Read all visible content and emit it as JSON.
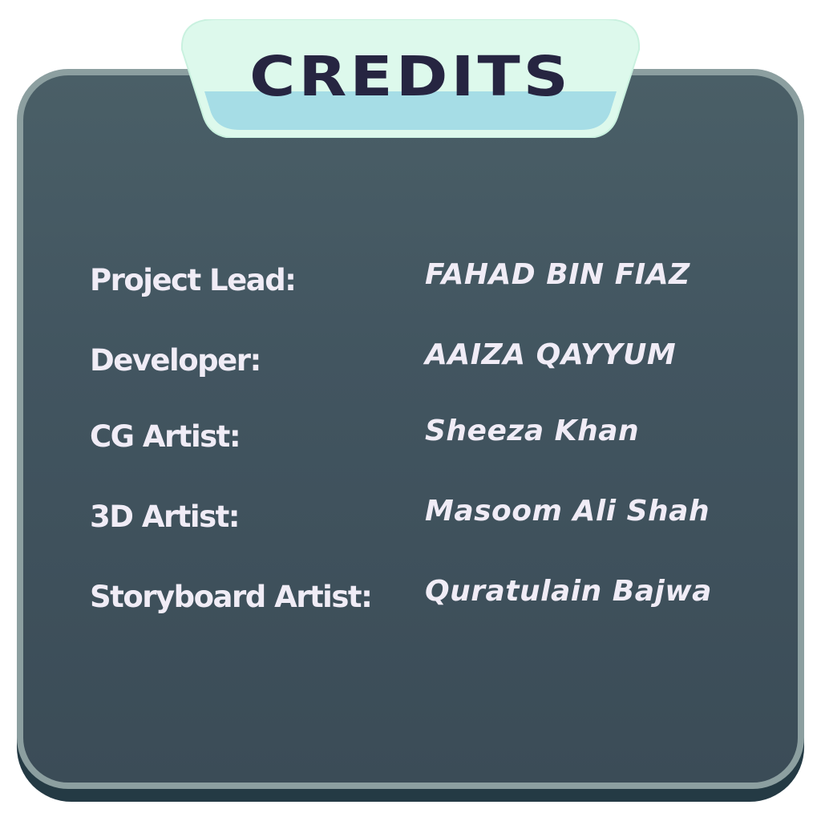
{
  "header": {
    "title": "CREDITS"
  },
  "credits": [
    {
      "role": "Project Lead:",
      "name": "FAHAD BIN FIAZ"
    },
    {
      "role": "Developer:",
      "name": "AAIZA QAYYUM"
    },
    {
      "role": "CG Artist:",
      "name": "Sheeza Khan"
    },
    {
      "role": "3D Artist:",
      "name": "Masoom Ali Shah"
    },
    {
      "role": "Storyboard Artist:",
      "name": "Quratulain Bajwa"
    }
  ],
  "colors": {
    "panel_top": "#4a5f67",
    "panel_bottom": "#3b4c57",
    "panel_border": "#8c9fa0",
    "panel_shadow": "#243a44",
    "tab_light": "#ddf9ec",
    "tab_band": "#a6dde6",
    "title_text": "#262541",
    "body_text": "#f0ecf6"
  }
}
